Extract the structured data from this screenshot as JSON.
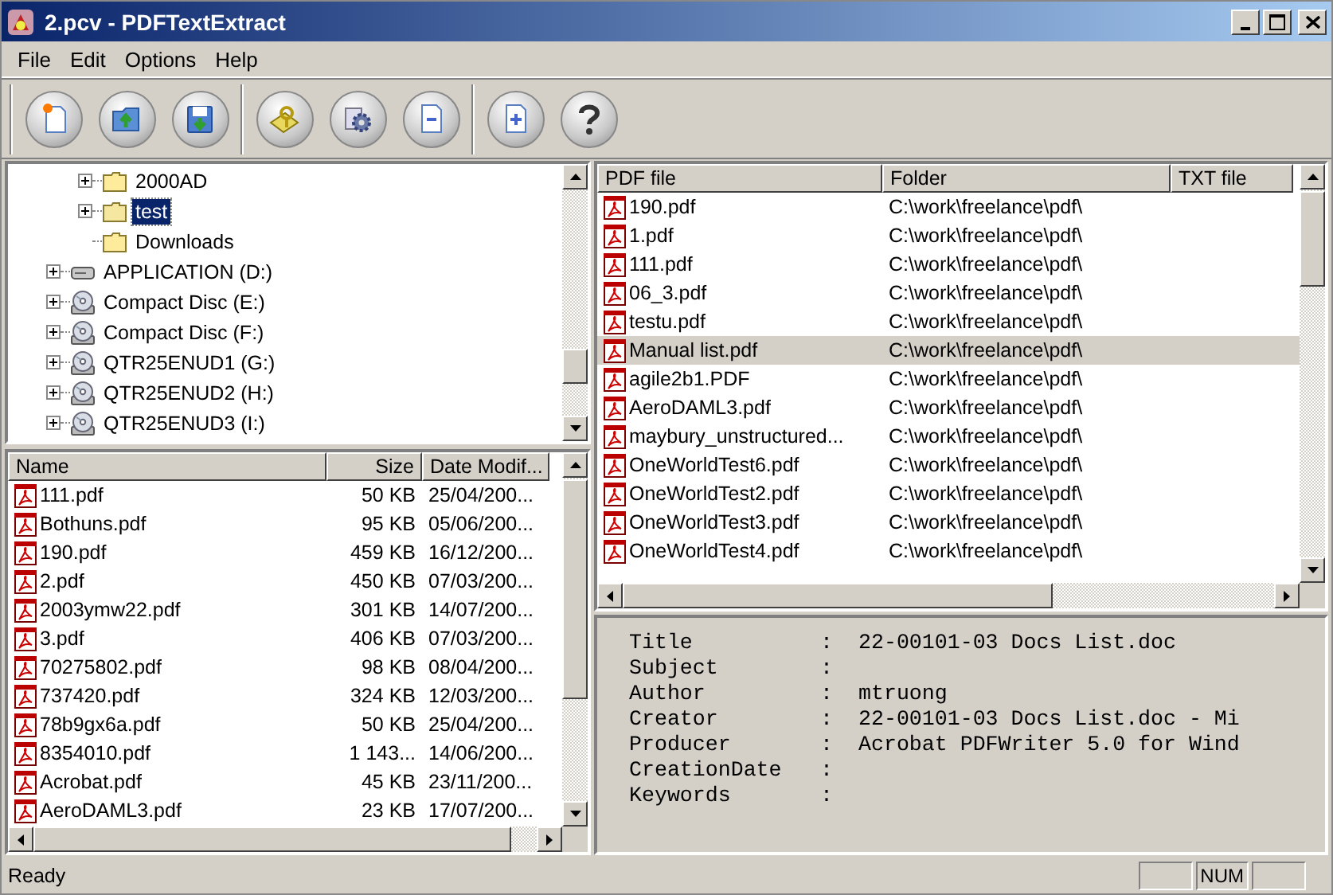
{
  "window": {
    "title": "2.pcv - PDFTextExtract"
  },
  "menu": [
    "File",
    "Edit",
    "Options",
    "Help"
  ],
  "toolbar": {
    "groups": [
      {
        "buttons": [
          {
            "kind": "new"
          },
          {
            "kind": "open"
          },
          {
            "kind": "save"
          }
        ]
      },
      {
        "buttons": [
          {
            "kind": "extract"
          },
          {
            "kind": "settings"
          },
          {
            "kind": "remove"
          }
        ]
      },
      {
        "buttons": [
          {
            "kind": "add"
          },
          {
            "kind": "help"
          }
        ]
      }
    ]
  },
  "tree": {
    "items": [
      {
        "children": [
          {
            "label": "2000AD",
            "kind": "folder",
            "expandable": true,
            "selected": false
          },
          {
            "label": "test",
            "kind": "folder",
            "expandable": true,
            "selected": true
          },
          {
            "label": "Downloads",
            "kind": "folder",
            "expandable": false,
            "selected": false
          }
        ]
      },
      {
        "label": "APPLICATION (D:)",
        "kind": "drive",
        "expandable": true,
        "selected": false
      },
      {
        "label": "Compact Disc (E:)",
        "kind": "cd",
        "expandable": true,
        "selected": false
      },
      {
        "label": "Compact Disc (F:)",
        "kind": "cd",
        "expandable": true,
        "selected": false
      },
      {
        "label": "QTR25ENUD1 (G:)",
        "kind": "cd",
        "expandable": true,
        "selected": false
      },
      {
        "label": "QTR25ENUD2 (H:)",
        "kind": "cd",
        "expandable": true,
        "selected": false
      },
      {
        "label": "QTR25ENUD3 (I:)",
        "kind": "cd",
        "expandable": true,
        "selected": false
      }
    ]
  },
  "file_list": {
    "columns": [
      "Name",
      "Size",
      "Date Modif..."
    ],
    "rows": [
      {
        "name": "111.pdf",
        "size": "50 KB",
        "date": "25/04/200..."
      },
      {
        "name": "Bothuns.pdf",
        "size": "95 KB",
        "date": "05/06/200..."
      },
      {
        "name": "190.pdf",
        "size": "459 KB",
        "date": "16/12/200..."
      },
      {
        "name": "2.pdf",
        "size": "450 KB",
        "date": "07/03/200..."
      },
      {
        "name": "2003ymw22.pdf",
        "size": "301 KB",
        "date": "14/07/200..."
      },
      {
        "name": "3.pdf",
        "size": "406 KB",
        "date": "07/03/200..."
      },
      {
        "name": "70275802.pdf",
        "size": "98 KB",
        "date": "08/04/200..."
      },
      {
        "name": "737420.pdf",
        "size": "324 KB",
        "date": "12/03/200..."
      },
      {
        "name": "78b9gx6a.pdf",
        "size": "50 KB",
        "date": "25/04/200..."
      },
      {
        "name": "8354010.pdf",
        "size": "1 143...",
        "date": "14/06/200..."
      },
      {
        "name": "Acrobat.pdf",
        "size": "45 KB",
        "date": "23/11/200..."
      },
      {
        "name": "AeroDAML3.pdf",
        "size": "23 KB",
        "date": "17/07/200..."
      }
    ]
  },
  "pdf_list": {
    "columns": [
      "PDF file",
      "Folder",
      "TXT file"
    ],
    "rows": [
      {
        "pdf": "190.pdf",
        "folder": "C:\\work\\freelance\\pdf\\",
        "selected": false
      },
      {
        "pdf": "1.pdf",
        "folder": "C:\\work\\freelance\\pdf\\",
        "selected": false
      },
      {
        "pdf": "111.pdf",
        "folder": "C:\\work\\freelance\\pdf\\",
        "selected": false
      },
      {
        "pdf": "06_3.pdf",
        "folder": "C:\\work\\freelance\\pdf\\",
        "selected": false
      },
      {
        "pdf": "testu.pdf",
        "folder": "C:\\work\\freelance\\pdf\\",
        "selected": false
      },
      {
        "pdf": "Manual list.pdf",
        "folder": "C:\\work\\freelance\\pdf\\",
        "selected": true
      },
      {
        "pdf": "agile2b1.PDF",
        "folder": "C:\\work\\freelance\\pdf\\",
        "selected": false
      },
      {
        "pdf": "AeroDAML3.pdf",
        "folder": "C:\\work\\freelance\\pdf\\",
        "selected": false
      },
      {
        "pdf": "maybury_unstructured...",
        "folder": "C:\\work\\freelance\\pdf\\",
        "selected": false
      },
      {
        "pdf": "OneWorldTest6.pdf",
        "folder": "C:\\work\\freelance\\pdf\\",
        "selected": false
      },
      {
        "pdf": "OneWorldTest2.pdf",
        "folder": "C:\\work\\freelance\\pdf\\",
        "selected": false
      },
      {
        "pdf": "OneWorldTest3.pdf",
        "folder": "C:\\work\\freelance\\pdf\\",
        "selected": false
      },
      {
        "pdf": "OneWorldTest4.pdf",
        "folder": "C:\\work\\freelance\\pdf\\",
        "selected": false
      }
    ]
  },
  "properties": [
    {
      "label": "Title",
      "separator": ":",
      "value": "22-00101-03 Docs List.doc"
    },
    {
      "label": "Subject",
      "separator": ":"
    },
    {
      "label": "Author",
      "separator": ":",
      "value": "mtruong"
    },
    {
      "label": "Creator",
      "separator": ":",
      "value": "22-00101-03 Docs List.doc - Mi"
    },
    {
      "label": "Producer",
      "separator": ":",
      "value": "Acrobat PDFWriter 5.0 for Wind"
    },
    {
      "label": "CreationDate",
      "separator": ":"
    },
    {
      "label": "Keywords",
      "separator": ":"
    }
  ],
  "status_bar": {
    "text": "Ready",
    "panels": [
      {
        "kind": "blank"
      },
      {
        "kind": "text",
        "text": "NUM"
      },
      {
        "kind": "blank"
      }
    ]
  }
}
